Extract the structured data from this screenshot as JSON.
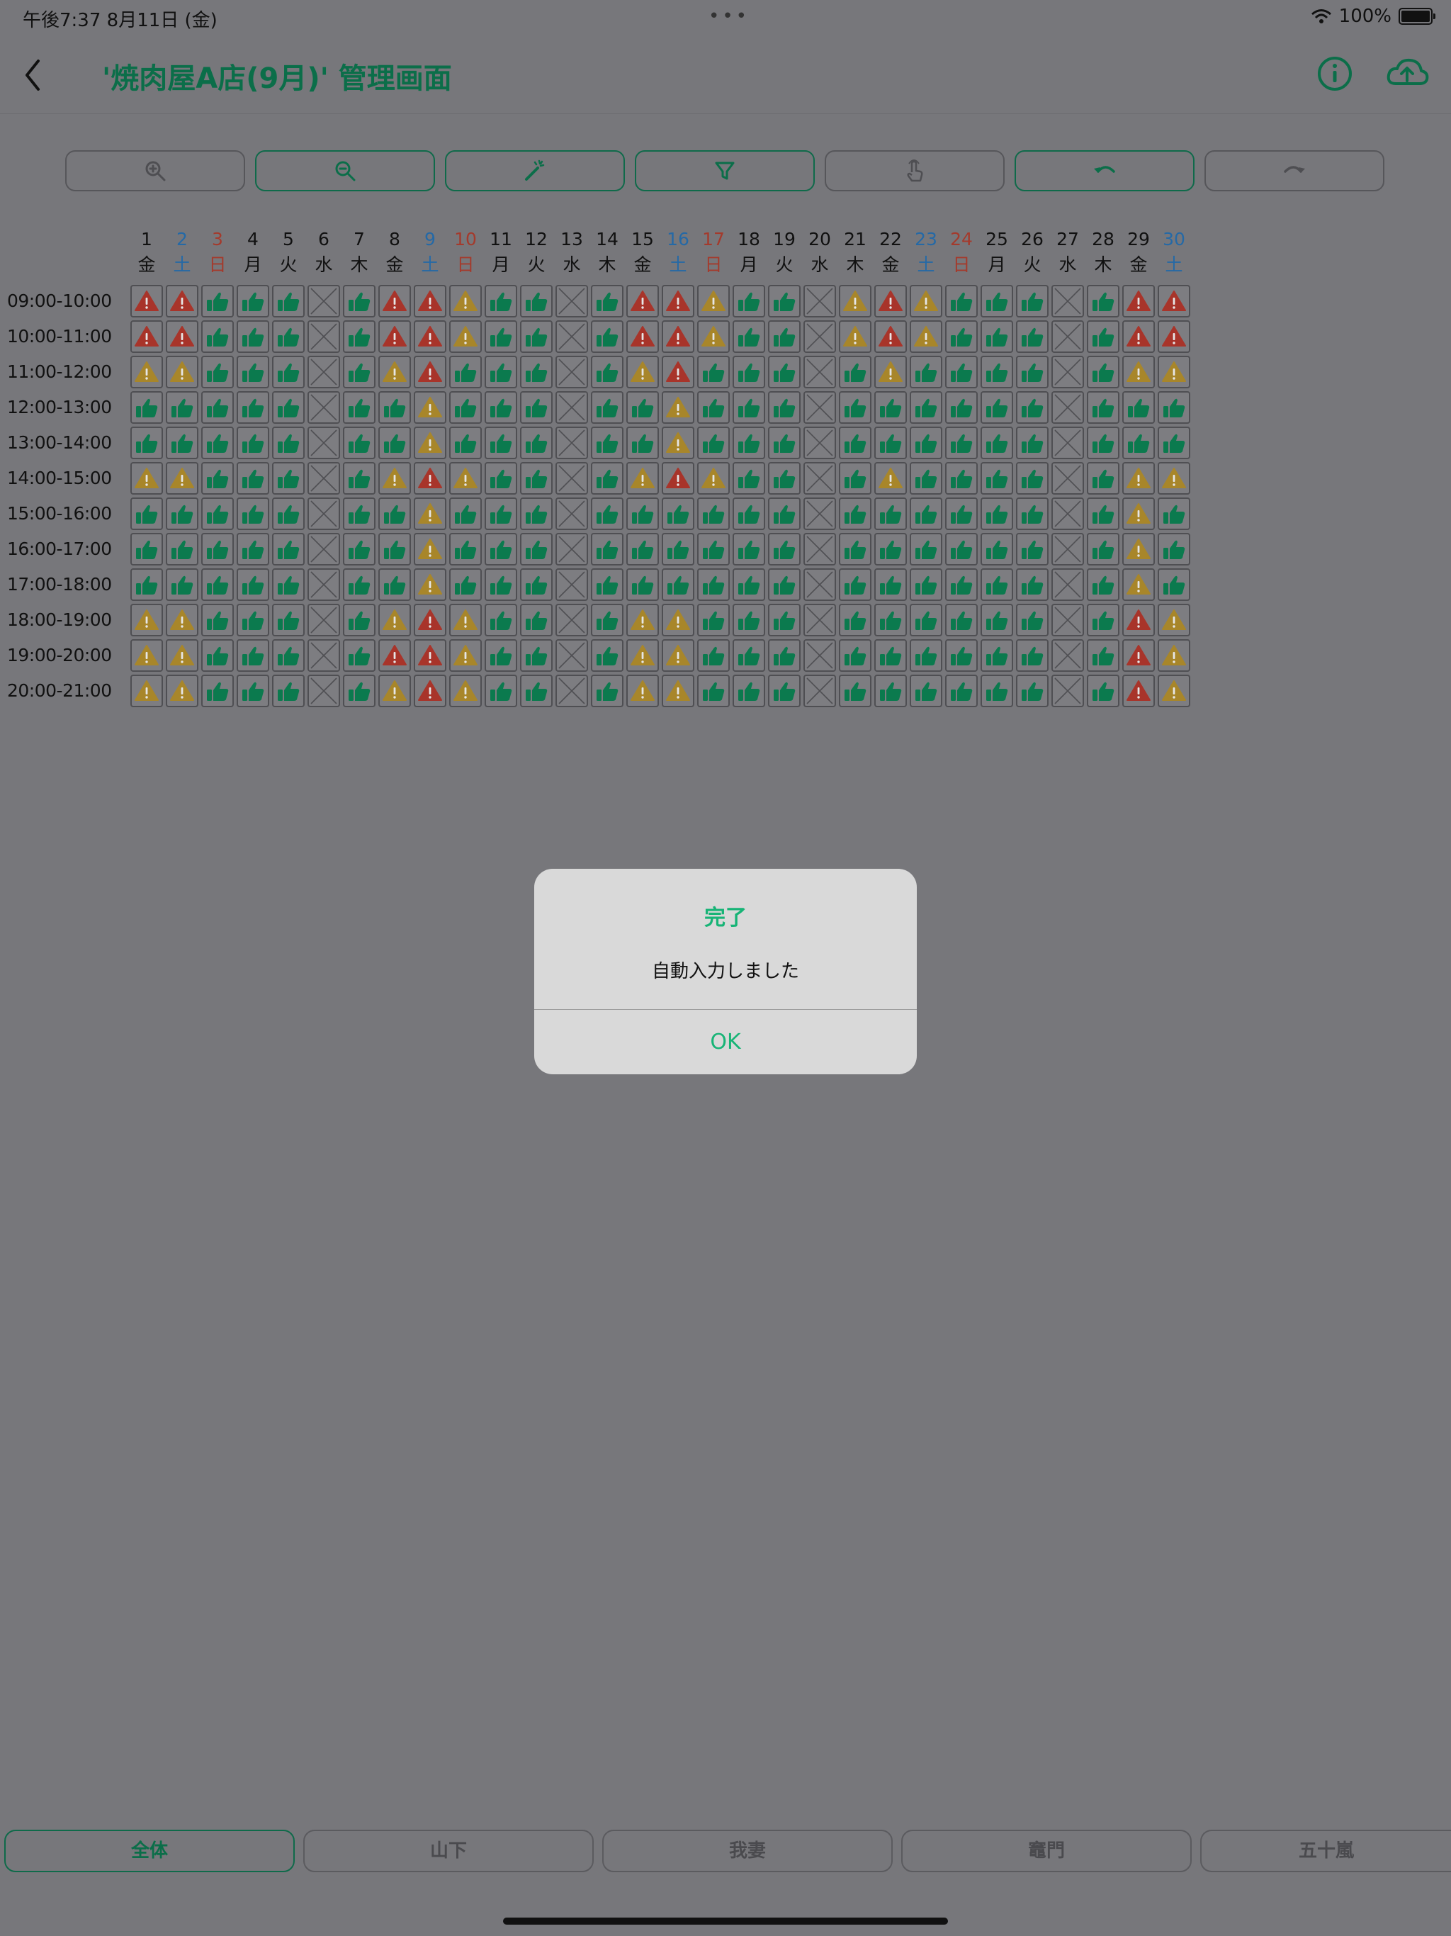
{
  "status_bar": {
    "time_date": "午後7:37   8月11日 (金)",
    "dots": "•••",
    "battery_pct": "100%",
    "battery_level": 1.0
  },
  "nav": {
    "title": "'焼肉屋A店(9月)' 管理画面",
    "back_icon": "chevron-left-icon",
    "info_icon": "info-circle-icon",
    "upload_icon": "cloud-upload-icon"
  },
  "toolbar": [
    {
      "icon": "zoom-in-icon",
      "enabled": false
    },
    {
      "icon": "zoom-out-icon",
      "enabled": true
    },
    {
      "icon": "magic-wand-icon",
      "enabled": true
    },
    {
      "icon": "filter-icon",
      "enabled": true
    },
    {
      "icon": "tap-hand-icon",
      "enabled": false
    },
    {
      "icon": "undo-icon",
      "enabled": true
    },
    {
      "icon": "redo-icon",
      "enabled": false
    }
  ],
  "days": [
    {
      "num": "1",
      "wd": "金",
      "kind": "weekday"
    },
    {
      "num": "2",
      "wd": "土",
      "kind": "sat"
    },
    {
      "num": "3",
      "wd": "日",
      "kind": "sun"
    },
    {
      "num": "4",
      "wd": "月",
      "kind": "weekday"
    },
    {
      "num": "5",
      "wd": "火",
      "kind": "weekday"
    },
    {
      "num": "6",
      "wd": "水",
      "kind": "weekday"
    },
    {
      "num": "7",
      "wd": "木",
      "kind": "weekday"
    },
    {
      "num": "8",
      "wd": "金",
      "kind": "weekday"
    },
    {
      "num": "9",
      "wd": "土",
      "kind": "sat"
    },
    {
      "num": "10",
      "wd": "日",
      "kind": "sun"
    },
    {
      "num": "11",
      "wd": "月",
      "kind": "weekday"
    },
    {
      "num": "12",
      "wd": "火",
      "kind": "weekday"
    },
    {
      "num": "13",
      "wd": "水",
      "kind": "weekday"
    },
    {
      "num": "14",
      "wd": "木",
      "kind": "weekday"
    },
    {
      "num": "15",
      "wd": "金",
      "kind": "weekday"
    },
    {
      "num": "16",
      "wd": "土",
      "kind": "sat"
    },
    {
      "num": "17",
      "wd": "日",
      "kind": "sun"
    },
    {
      "num": "18",
      "wd": "月",
      "kind": "weekday"
    },
    {
      "num": "19",
      "wd": "火",
      "kind": "weekday"
    },
    {
      "num": "20",
      "wd": "水",
      "kind": "weekday"
    },
    {
      "num": "21",
      "wd": "木",
      "kind": "weekday"
    },
    {
      "num": "22",
      "wd": "金",
      "kind": "weekday"
    },
    {
      "num": "23",
      "wd": "土",
      "kind": "sat"
    },
    {
      "num": "24",
      "wd": "日",
      "kind": "sun"
    },
    {
      "num": "25",
      "wd": "月",
      "kind": "weekday"
    },
    {
      "num": "26",
      "wd": "火",
      "kind": "weekday"
    },
    {
      "num": "27",
      "wd": "水",
      "kind": "weekday"
    },
    {
      "num": "28",
      "wd": "木",
      "kind": "weekday"
    },
    {
      "num": "29",
      "wd": "金",
      "kind": "weekday"
    },
    {
      "num": "30",
      "wd": "土",
      "kind": "sat"
    }
  ],
  "time_slots": [
    "09:00-10:00",
    "10:00-11:00",
    "11:00-12:00",
    "12:00-13:00",
    "13:00-14:00",
    "14:00-15:00",
    "15:00-16:00",
    "16:00-17:00",
    "17:00-18:00",
    "18:00-19:00",
    "19:00-20:00",
    "20:00-21:00"
  ],
  "cell_legend": {
    "G": "thumbs-up-icon",
    "R": "warning-red-icon",
    "Y": "warning-yellow-icon",
    "X": "closed-x-icon"
  },
  "colors": {
    "green": "#0b7a4e",
    "red": "#a8342a",
    "yellow": "#a8862a",
    "accent": "#17b476"
  },
  "schedule": [
    "RRGGGXGRRYGGXGRRYGGXYRYGGGXGRR",
    "RRGGGXGRRYGGXGRRYGGXYRYGGGXGRR",
    "YYGGGXGYRGGGXGYRGGGXGYGGGGXGYY",
    "GGGGGXGGYGGGXGGYGGGXGGGGGGXGGG",
    "GGGGGXGGYGGGXGGYGGGXGGGGGGXGGG",
    "YYGGGXGYRYGGXGYRYGGXGYGGGGXGYY",
    "GGGGGXGGYGGGXGGGGGGXGGGGGGXGYG",
    "GGGGGXGGYGGGXGGGGGGXGGGGGGXGYG",
    "GGGGGXGGYGGGXGGGGGGXGGGGGGXGYG",
    "YYGGGXGYRYGGXGYYGGGXGGGGGGXGRY",
    "YYGGGXGRRYGGXGYYGGGXGGGGGGXGRY",
    "YYGGGXGYRYGGXGYYGGGXGGGGGGXGRY"
  ],
  "alert": {
    "title": "完了",
    "message": "自動入力しました",
    "ok_label": "OK"
  },
  "bottom_tabs": [
    {
      "label": "全体",
      "active": true
    },
    {
      "label": "山下",
      "active": false
    },
    {
      "label": "我妻",
      "active": false
    },
    {
      "label": "竈門",
      "active": false
    },
    {
      "label": "五十嵐",
      "active": false
    }
  ]
}
